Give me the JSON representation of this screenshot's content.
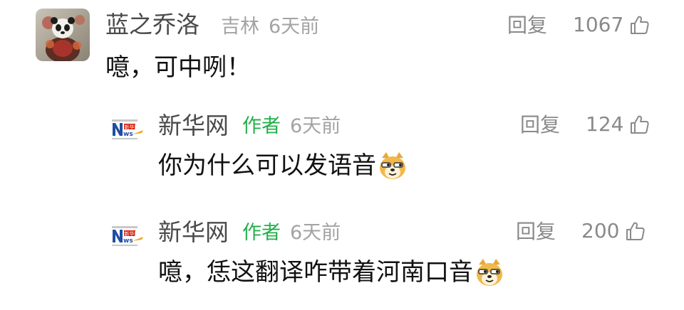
{
  "comments": [
    {
      "username": "蓝之乔洛",
      "location": "吉林",
      "time": "6天前",
      "reply_label": "回复",
      "likes": "1067",
      "text": "噫，可中咧！",
      "avatar": "panda-warrior-avatar"
    },
    {
      "username": "新华网",
      "author_tag": "作者",
      "time": "6天前",
      "reply_label": "回复",
      "likes": "124",
      "text": "你为什么可以发语音",
      "emoji": "doge-emoji",
      "avatar": "xinhuanet-logo-avatar"
    },
    {
      "username": "新华网",
      "author_tag": "作者",
      "time": "6天前",
      "reply_label": "回复",
      "likes": "200",
      "text": "噫，恁这翻译咋带着河南口音",
      "emoji": "doge-emoji",
      "avatar": "xinhuanet-logo-avatar"
    }
  ],
  "colors": {
    "author_tag": "#22b04b",
    "username": "#4a4a4a",
    "meta": "#a3a3a3",
    "text": "#111111"
  }
}
